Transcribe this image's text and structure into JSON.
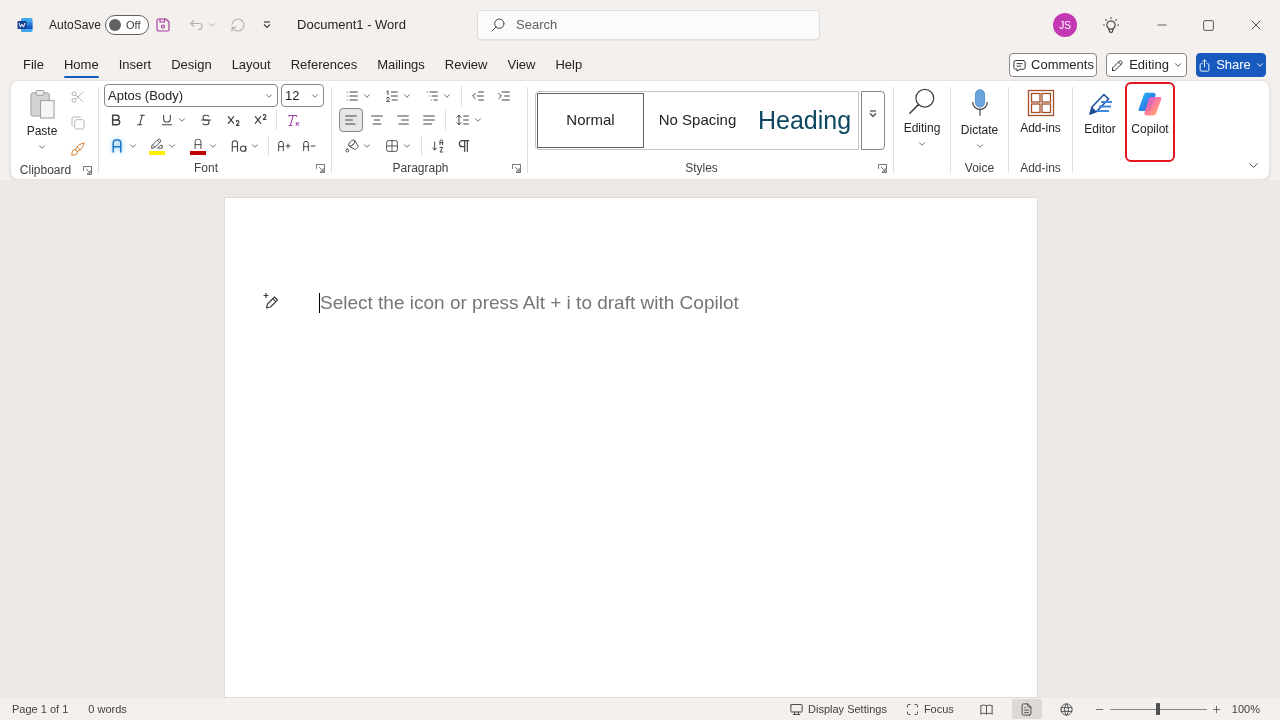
{
  "title_bar": {
    "autosave": {
      "label": "AutoSave",
      "on": false,
      "state_text": "Off"
    },
    "quick_access": [
      {
        "kind": "save",
        "disabled": false
      },
      {
        "kind": "undo",
        "disabled": true
      },
      {
        "kind": "redo",
        "disabled": true
      }
    ],
    "document_title": "Document1 - Word",
    "search": {
      "placeholder": "Search"
    },
    "account": {
      "initials": "JS"
    }
  },
  "ribbon_tabs": [
    {
      "label": "File",
      "selected": false
    },
    {
      "label": "Home",
      "selected": true
    },
    {
      "label": "Insert",
      "selected": false
    },
    {
      "label": "Design",
      "selected": false
    },
    {
      "label": "Layout",
      "selected": false
    },
    {
      "label": "References",
      "selected": false
    },
    {
      "label": "Mailings",
      "selected": false
    },
    {
      "label": "Review",
      "selected": false
    },
    {
      "label": "View",
      "selected": false
    },
    {
      "label": "Help",
      "selected": false
    }
  ],
  "ribbon_actions": [
    {
      "kind": "comments",
      "label": "Comments"
    },
    {
      "kind": "editing",
      "label": "Editing"
    },
    {
      "kind": "share",
      "label": "Share"
    }
  ],
  "ribbon": {
    "clipboard": {
      "label": "Clipboard",
      "paste": "Paste",
      "tools": [
        {
          "kind": "cut",
          "disabled": true
        },
        {
          "kind": "copy",
          "disabled": true
        },
        {
          "kind": "format_painter",
          "disabled": false
        }
      ]
    },
    "font": {
      "label": "Font",
      "font_name": "Aptos (Body)",
      "font_size": "12"
    },
    "paragraph": {
      "label": "Paragraph",
      "alignments": [
        {
          "kind": "left",
          "selected": true
        },
        {
          "kind": "center",
          "selected": false
        },
        {
          "kind": "right",
          "selected": false
        },
        {
          "kind": "justify",
          "selected": false
        }
      ]
    },
    "styles": {
      "label": "Styles",
      "items": [
        {
          "kind": "normal",
          "label": "Normal",
          "selected": true
        },
        {
          "kind": "no_spacing",
          "label": "No Spacing",
          "selected": false
        },
        {
          "kind": "heading",
          "label": "Heading",
          "selected": false
        }
      ]
    },
    "editing": {
      "button": "Editing"
    },
    "voice": {
      "label": "Voice",
      "button": "Dictate"
    },
    "add_ins": {
      "label": "Add-ins",
      "button": "Add-ins"
    },
    "editor": {
      "button": "Editor"
    },
    "copilot": {
      "button": "Copilot",
      "highlighted": true
    }
  },
  "document": {
    "prompt": "Select the icon or press Alt + i to draft with Copilot"
  },
  "status_bar": {
    "page": "Page 1 of 1",
    "words": "0 words",
    "display_settings": "Display Settings",
    "focus": "Focus",
    "views": [
      {
        "kind": "read",
        "selected": false
      },
      {
        "kind": "print",
        "selected": true
      },
      {
        "kind": "web",
        "selected": false
      }
    ],
    "zoom": {
      "level": 0.5,
      "reading": "100%"
    }
  }
}
